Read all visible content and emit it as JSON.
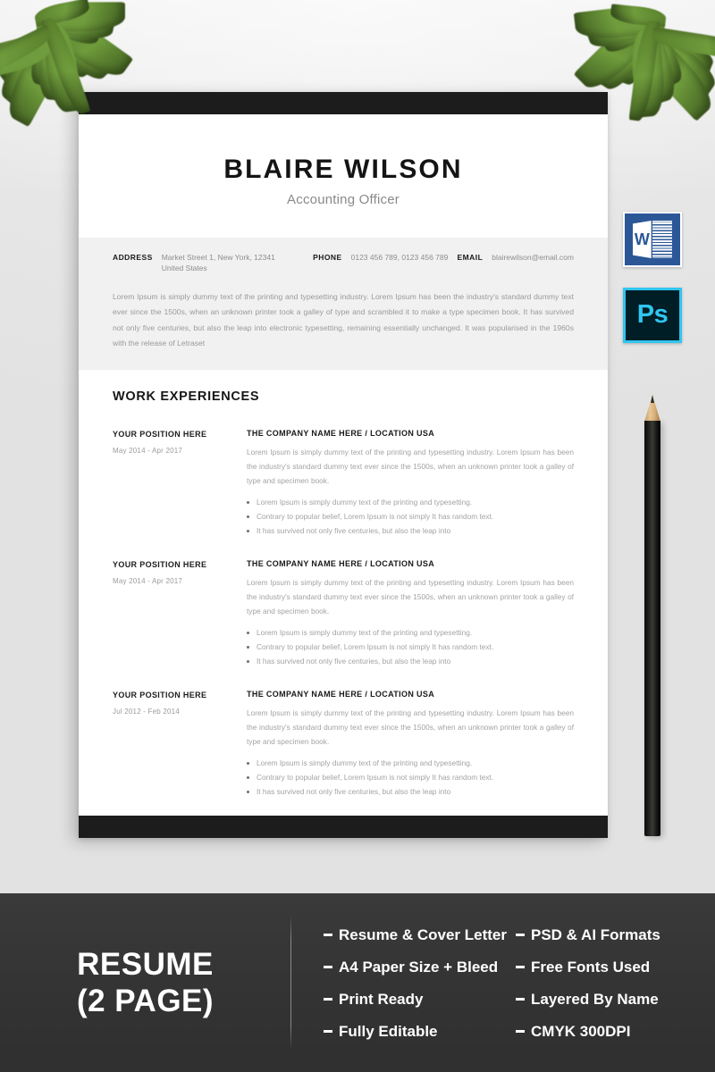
{
  "resume": {
    "name": "BLAIRE WILSON",
    "job_title": "Accounting Officer",
    "contact": {
      "address_label": "ADDRESS",
      "address_value": "Market Street 1, New York, 12341\nUnited States",
      "phone_label": "PHONE",
      "phone_value": "0123 456 789, 0123 456 789",
      "email_label": "EMAIL",
      "email_value": "blairewilson@email.com"
    },
    "summary": "Lorem Ipsum is simply dummy text of the printing and typesetting industry. Lorem Ipsum has been the industry's standard dummy text ever since the 1500s, when an unknown printer took a galley of type and scrambled it to make a type specimen book. It has survived not only five centuries, but also the leap into electronic typesetting, remaining essentially unchanged. It was popularised in the 1960s with the release of Letraset",
    "section_heading": "WORK EXPERIENCES",
    "jobs": [
      {
        "position": "YOUR POSITION HERE",
        "dates": "May 2014 - Apr 2017",
        "company": "THE COMPANY NAME HERE / LOCATION USA",
        "description": "Lorem Ipsum is simply dummy text of the printing and typesetting industry. Lorem Ipsum has been the industry's standard dummy text ever since the 1500s, when an unknown printer took a galley of type and specimen book.",
        "bullets": [
          "Lorem Ipsum is simply dummy text of the printing and typesetting.",
          "Contrary to popular belief, Lorem Ipsum is not simply It has  random text.",
          "It has survived not only five centuries, but also the leap into"
        ]
      },
      {
        "position": "YOUR POSITION HERE",
        "dates": "May 2014 - Apr 2017",
        "company": "THE COMPANY NAME HERE / LOCATION USA",
        "description": "Lorem Ipsum is simply dummy text of the printing and typesetting industry. Lorem Ipsum has been the industry's standard dummy text ever since the 1500s, when an unknown printer took a galley of type and specimen book.",
        "bullets": [
          "Lorem Ipsum is simply dummy text of the printing and typesetting.",
          "Contrary to popular belief, Lorem Ipsum is not simply It has  random text.",
          "It has survived not only five centuries, but also the leap into"
        ]
      },
      {
        "position": "YOUR POSITION HERE",
        "dates": "Jul 2012 - Feb 2014",
        "company": "THE COMPANY NAME HERE / LOCATION USA",
        "description": "Lorem Ipsum is simply dummy text of the printing and typesetting industry. Lorem Ipsum has been the industry's standard dummy text ever since the 1500s, when an unknown printer took a galley of type and specimen book.",
        "bullets": [
          "Lorem Ipsum is simply dummy text of the printing and typesetting.",
          "Contrary to popular belief, Lorem Ipsum is not simply It has  random text.",
          "It has survived not only five centuries, but also the leap into"
        ]
      }
    ]
  },
  "side_icons": {
    "word": {
      "icon": "microsoft-word-icon",
      "letter": "W"
    },
    "photoshop": {
      "icon": "adobe-photoshop-icon",
      "letter": "Ps"
    },
    "pencil": {
      "icon": "pencil-icon"
    }
  },
  "banner": {
    "title_line_1": "RESUME",
    "title_line_2": "(2 PAGE)",
    "features_column_1": [
      "Resume & Cover Letter",
      "A4 Paper Size + Bleed",
      "Print Ready",
      "Fully Editable"
    ],
    "features_column_2": [
      "PSD & AI Formats",
      "Free Fonts Used",
      "Layered By Name",
      "CMYK 300DPI"
    ]
  },
  "colors": {
    "page_bar": "#1c1c1c",
    "banner_bg": "#343434",
    "grey_band": "#f1f1f1",
    "word_blue": "#2b5797",
    "photoshop_cyan": "#31c5f0",
    "photoshop_bg": "#001e26",
    "leaf_green": "#6f9c3c"
  }
}
